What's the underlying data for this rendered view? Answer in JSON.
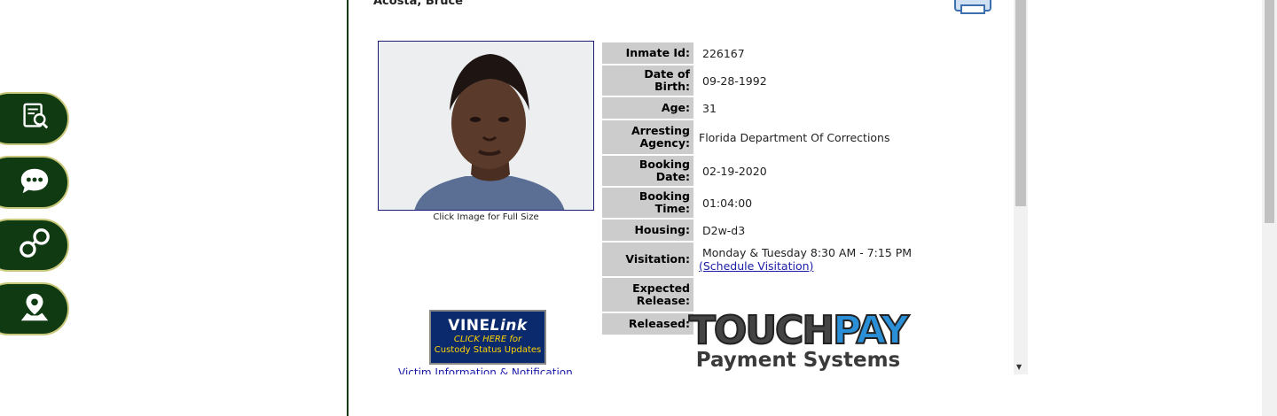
{
  "inmate": {
    "name": "Acosta, Bruce",
    "photo_caption": "Click Image for Full Size"
  },
  "details": [
    {
      "label": "Inmate Id:",
      "value": "226167"
    },
    {
      "label": "Date of Birth:",
      "value": "09-28-1992"
    },
    {
      "label": "Age:",
      "value": "31"
    },
    {
      "label": "Arresting Agency:",
      "value": "Florida Department Of Corrections"
    },
    {
      "label": "Booking Date:",
      "value": "02-19-2020"
    },
    {
      "label": "Booking Time:",
      "value": "01:04:00"
    },
    {
      "label": "Housing:",
      "value": "D2w-d3"
    },
    {
      "label": "Visitation:",
      "value": "Monday & Tuesday 8:30 AM - 7:15 PM",
      "link": "(Schedule Visitation)"
    },
    {
      "label": "Expected Release:",
      "value": ""
    },
    {
      "label": "Released:",
      "value": ""
    }
  ],
  "vine": {
    "logo_a": "VINE",
    "logo_b": "Link",
    "click_text": "CLICK HERE for",
    "status_text": "Custody Status Updates",
    "victim_link": "Victim Information & Notification"
  },
  "touchpay": {
    "touch": "TOUCH",
    "pay": "PAY",
    "sub": "Payment Systems"
  },
  "side_nav": [
    {
      "icon": "document-search-icon"
    },
    {
      "icon": "chat-bubble-icon"
    },
    {
      "icon": "handcuffs-icon"
    },
    {
      "icon": "map-pin-icon"
    }
  ],
  "colors": {
    "nav_bg": "#0f3a12",
    "nav_border": "#c9c77a",
    "label_bg": "#cccccc",
    "link": "#1a1aa8"
  }
}
